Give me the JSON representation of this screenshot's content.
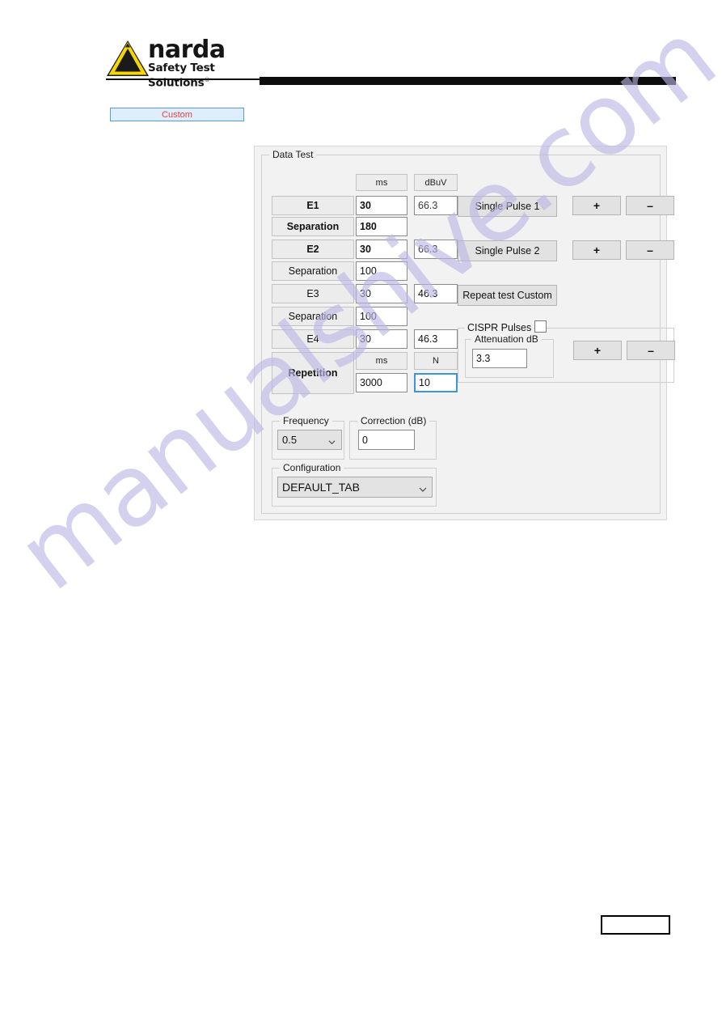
{
  "header": {
    "brand_name": "narda",
    "brand_tagline": "Safety Test Solutions",
    "brand_registered": "®",
    "logo_icon": "warning-triangle-icon"
  },
  "tab": {
    "label": "Custom"
  },
  "panel": {
    "group_title": "Data Test",
    "unit_headers": {
      "ms": "ms",
      "dbuv": "dBuV",
      "n": "N"
    },
    "rows": [
      {
        "label": "E1",
        "ms": "30",
        "dbuv": "66.3",
        "label_bold": true,
        "ms_bold": true
      },
      {
        "label": "Separation",
        "ms": "180",
        "dbuv": "",
        "label_bold": true,
        "ms_bold": true
      },
      {
        "label": "E2",
        "ms": "30",
        "dbuv": "66.3",
        "label_bold": true,
        "ms_bold": true
      },
      {
        "label": "Separation",
        "ms": "100",
        "dbuv": "",
        "label_bold": false,
        "ms_bold": false
      },
      {
        "label": "E3",
        "ms": "30",
        "dbuv": "46.3",
        "label_bold": false,
        "ms_bold": false
      },
      {
        "label": "Separation",
        "ms": "100",
        "dbuv": "",
        "label_bold": false,
        "ms_bold": false
      },
      {
        "label": "E4",
        "ms": "30",
        "dbuv": "46.3",
        "label_bold": false,
        "ms_bold": false
      }
    ],
    "repetition": {
      "label": "Repetition",
      "ms_value": "3000",
      "n_value": "10"
    },
    "buttons": {
      "single_pulse_1": "Single Pulse 1",
      "single_pulse_2": "Single Pulse 2",
      "repeat_test_custom": "Repeat test Custom",
      "plus": "+",
      "minus": "–"
    },
    "cispr": {
      "label": "CISPR Pulses",
      "checked": false,
      "attenuation_label": "Attenuation dB",
      "attenuation_value": "3.3"
    },
    "frequency": {
      "label": "Frequency",
      "value": "0.5"
    },
    "correction": {
      "label": "Correction (dB)",
      "value": "0"
    },
    "configuration": {
      "label": "Configuration",
      "value": "DEFAULT_TAB"
    }
  },
  "watermark": {
    "text": "manualshive.com",
    "color": "#b9b6e4"
  },
  "colors": {
    "accent_blue": "#3a96dd",
    "tab_text_red": "#e8413d",
    "logo_yellow": "#f5d505",
    "panel_bg": "#f2f2f2"
  }
}
